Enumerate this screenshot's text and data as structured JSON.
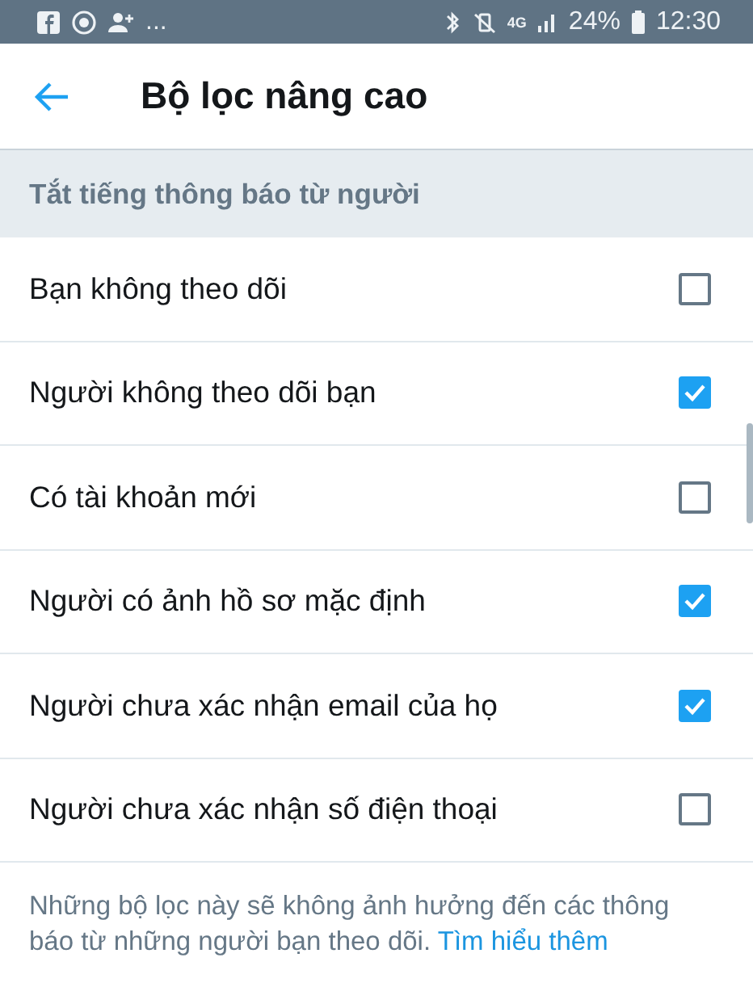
{
  "status_bar": {
    "overflow": "...",
    "network": "4G",
    "battery": "24%",
    "time": "12:30"
  },
  "header": {
    "title": "Bộ lọc nâng cao"
  },
  "section": {
    "title": "Tắt tiếng thông báo từ người"
  },
  "options": [
    {
      "label": "Bạn không theo dõi",
      "checked": false
    },
    {
      "label": "Người không theo dõi bạn",
      "checked": true
    },
    {
      "label": "Có tài khoản mới",
      "checked": false
    },
    {
      "label": "Người có ảnh hồ sơ mặc định",
      "checked": true
    },
    {
      "label": "Người chưa xác nhận email của họ",
      "checked": true
    },
    {
      "label": "Người chưa xác nhận số điện thoại",
      "checked": false
    }
  ],
  "footer": {
    "text": "Những bộ lọc này sẽ không ảnh hưởng đến các thông báo từ những người bạn theo dõi.",
    "link": "Tìm hiểu thêm"
  }
}
